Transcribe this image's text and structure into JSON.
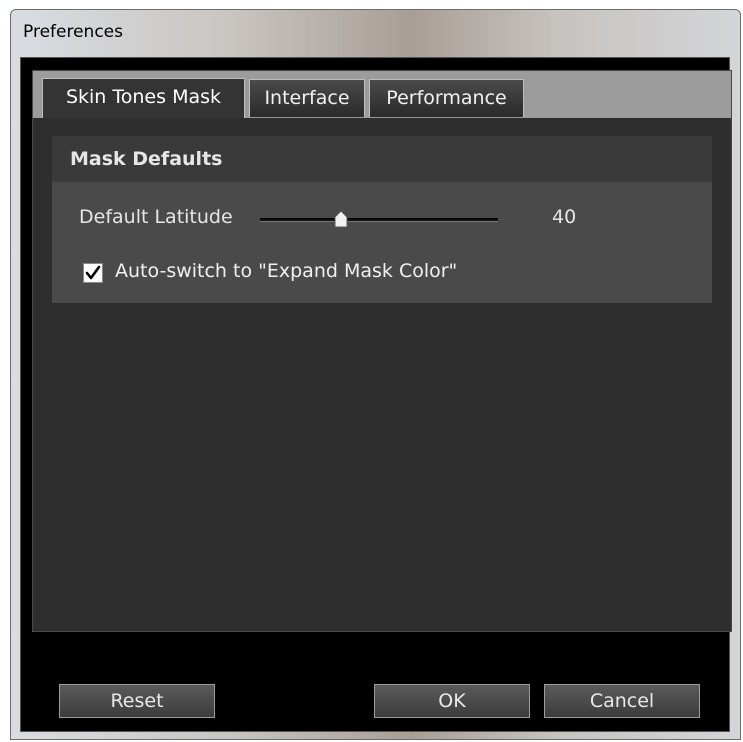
{
  "window": {
    "title": "Preferences"
  },
  "tabs": [
    {
      "label": "Skin Tones Mask",
      "active": true
    },
    {
      "label": "Interface",
      "active": false
    },
    {
      "label": "Performance",
      "active": false
    }
  ],
  "mask_defaults": {
    "title": "Mask Defaults",
    "latitude": {
      "label": "Default Latitude",
      "value": "40",
      "slider_fraction": 0.34
    },
    "autoswitch": {
      "label": "Auto-switch to \"Expand Mask Color\"",
      "checked": true
    }
  },
  "buttons": {
    "reset": "Reset",
    "ok": "OK",
    "cancel": "Cancel"
  },
  "colors": {
    "panel": "#2e2e2e",
    "group": "#4a4a4a",
    "tab_strip": "#9c9c9c"
  }
}
